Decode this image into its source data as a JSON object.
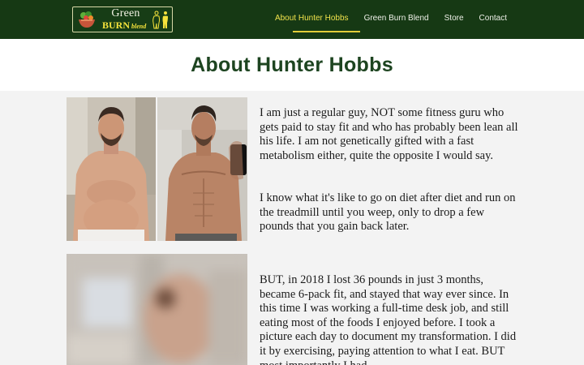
{
  "header": {
    "logo": {
      "line1": "Green",
      "line2": "BURN",
      "line3": "blend"
    },
    "nav": [
      {
        "label": "About Hunter Hobbs",
        "active": true
      },
      {
        "label": "Green Burn Blend",
        "active": false
      },
      {
        "label": "Store",
        "active": false
      },
      {
        "label": "Contact",
        "active": false
      }
    ],
    "colors": {
      "bar": "#163914",
      "active": "#f0e24b"
    }
  },
  "page": {
    "title": "About Hunter Hobbs"
  },
  "content": {
    "paragraphs": [
      "I am just a regular guy, NOT some fitness guru who gets paid to stay fit and who has probably been lean all his life. I am not genetically gifted with a fast metabolism either, quite the opposite I would say.",
      "I know what it's like to go on diet after diet and run on the treadmill until you weep, only to drop a few pounds that you gain back later.",
      "BUT, in 2018 I lost 36 pounds in just 3 months, became 6-pack fit, and stayed that way ever since. In this time I was working a full-time desk job, and still eating most of the foods I enjoyed before. I took a picture each day to document my transformation. I did it by exercising, paying attention to what I eat. BUT most importantly I had"
    ],
    "photos": [
      {
        "subject": "before-photo"
      },
      {
        "subject": "after-photo"
      },
      {
        "subject": "blurred-photo"
      }
    ]
  }
}
